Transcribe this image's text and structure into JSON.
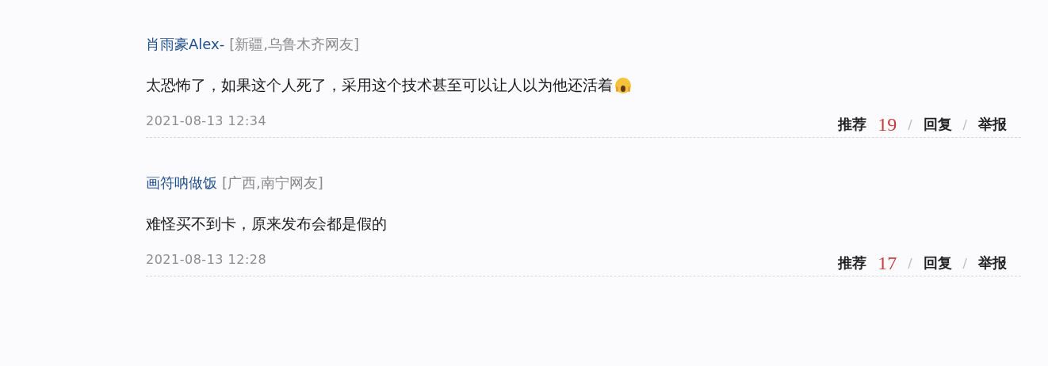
{
  "comments": [
    {
      "author": "肖雨豪Alex-",
      "location": "[新疆,乌鲁木齐网友]",
      "text": "太恐怖了，如果这个人死了，采用这个技术甚至可以让人以为他还活着",
      "emoji": true,
      "time": "2021-08-13 12:34",
      "actions": [
        {
          "label": "推荐",
          "count": "19"
        },
        {
          "separator": "/",
          "label": "回复"
        },
        {
          "separator": "/",
          "label": "举报"
        }
      ]
    },
    {
      "author": "画符呐做饭",
      "location": "[广西,南宁网友]",
      "text": "难怪买不到卡，原来发布会都是假的",
      "emoji": false,
      "time": "2021-08-13 12:28",
      "actions": [
        {
          "label": "推荐",
          "count": "17"
        },
        {
          "separator": "/",
          "label": "回复"
        },
        {
          "separator": "/",
          "label": "举报"
        }
      ]
    }
  ]
}
